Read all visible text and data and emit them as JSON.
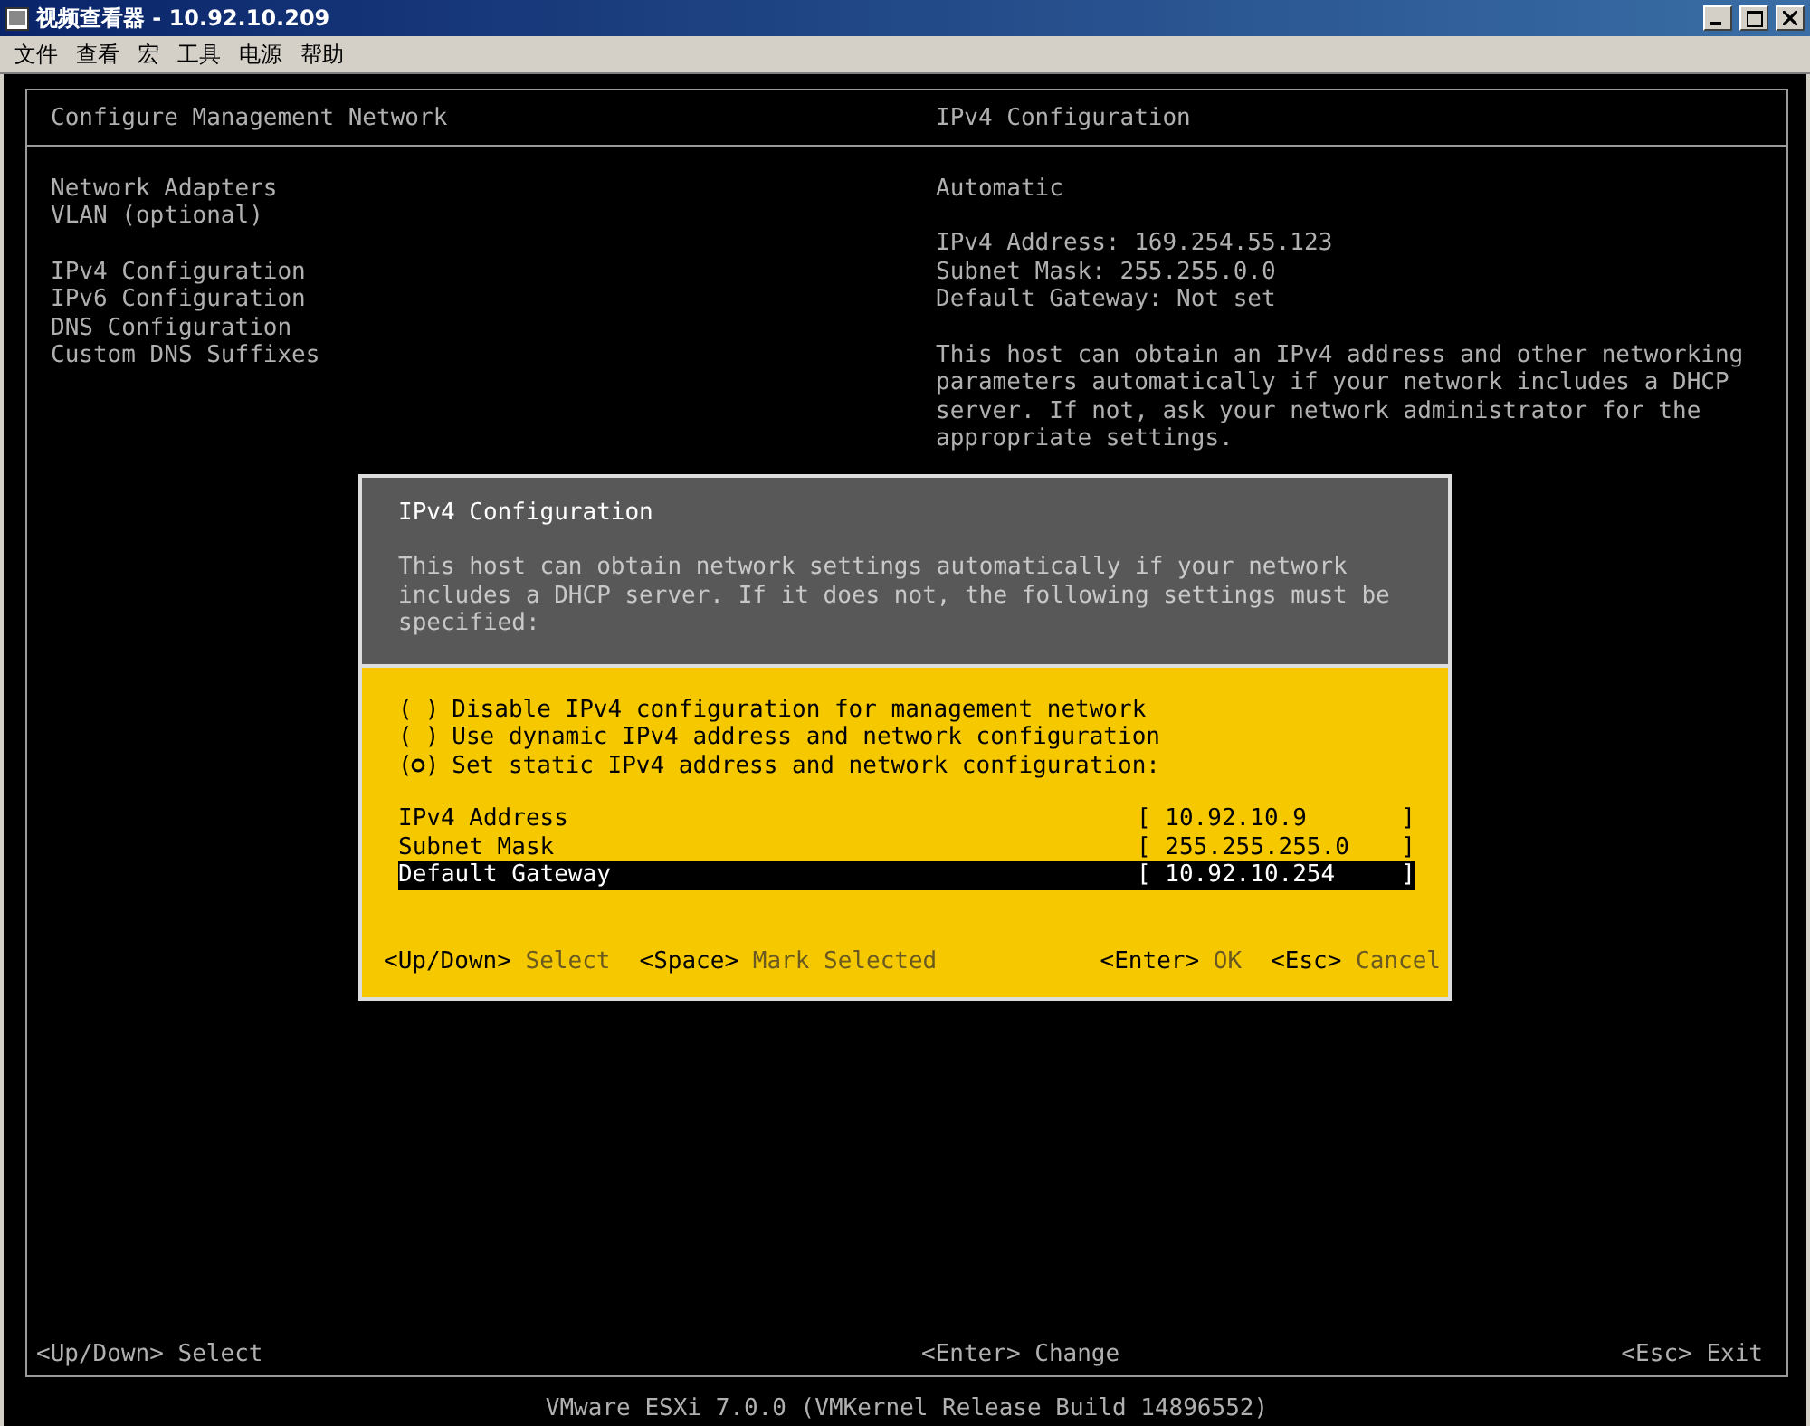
{
  "window": {
    "title": "视频查看器 - 10.92.10.209"
  },
  "menu": [
    "文件",
    "查看",
    "宏",
    "工具",
    "电源",
    "帮助"
  ],
  "console": {
    "left_title": "Configure Management Network",
    "right_title": "IPv4 Configuration",
    "menu_groups": [
      [
        "Network Adapters",
        "VLAN (optional)"
      ],
      [
        "IPv4 Configuration",
        "IPv6 Configuration",
        "DNS Configuration",
        "Custom DNS Suffixes"
      ]
    ],
    "info": {
      "mode": "Automatic",
      "lines": [
        "IPv4 Address: 169.254.55.123",
        "Subnet Mask: 255.255.0.0",
        "Default Gateway: Not set"
      ],
      "description": "This host can obtain an IPv4 address and other networking parameters automatically if your network includes a DHCP server. If not, ask your network administrator for the appropriate settings."
    },
    "footer_left": {
      "key": "<Up/Down>",
      "action": "Select"
    },
    "footer_right": {
      "key": "<Enter>",
      "action": "Change"
    },
    "footer_far": {
      "key": "<Esc>",
      "action": "Exit"
    },
    "version": "VMware ESXi 7.0.0 (VMKernel Release Build 14896552)"
  },
  "dialog": {
    "title": "IPv4 Configuration",
    "message": "This host can obtain network settings automatically if your network includes a DHCP server. If it does not, the following settings must be specified:",
    "radio_open": "(",
    "radio_close": ")",
    "options": [
      {
        "label": "Disable IPv4 configuration for management network",
        "selected": false
      },
      {
        "label": "Use dynamic IPv4 address and network configuration",
        "selected": false
      },
      {
        "label": "Set static IPv4 address and network configuration:",
        "selected": true
      }
    ],
    "fields": [
      {
        "label": "IPv4 Address",
        "value": "10.92.10.9",
        "selected": false
      },
      {
        "label": "Subnet Mask",
        "value": "255.255.255.0",
        "selected": false
      },
      {
        "label": "Default Gateway",
        "value": "10.92.10.254",
        "selected": true
      }
    ],
    "open_bracket": "[",
    "close_bracket": "]",
    "hints_left": [
      {
        "key": "<Up/Down>",
        "action": "Select"
      },
      {
        "key": "<Space>",
        "action": "Mark Selected"
      }
    ],
    "hints_right": [
      {
        "key": "<Enter>",
        "action": "OK"
      },
      {
        "key": "<Esc>",
        "action": "Cancel"
      }
    ]
  }
}
